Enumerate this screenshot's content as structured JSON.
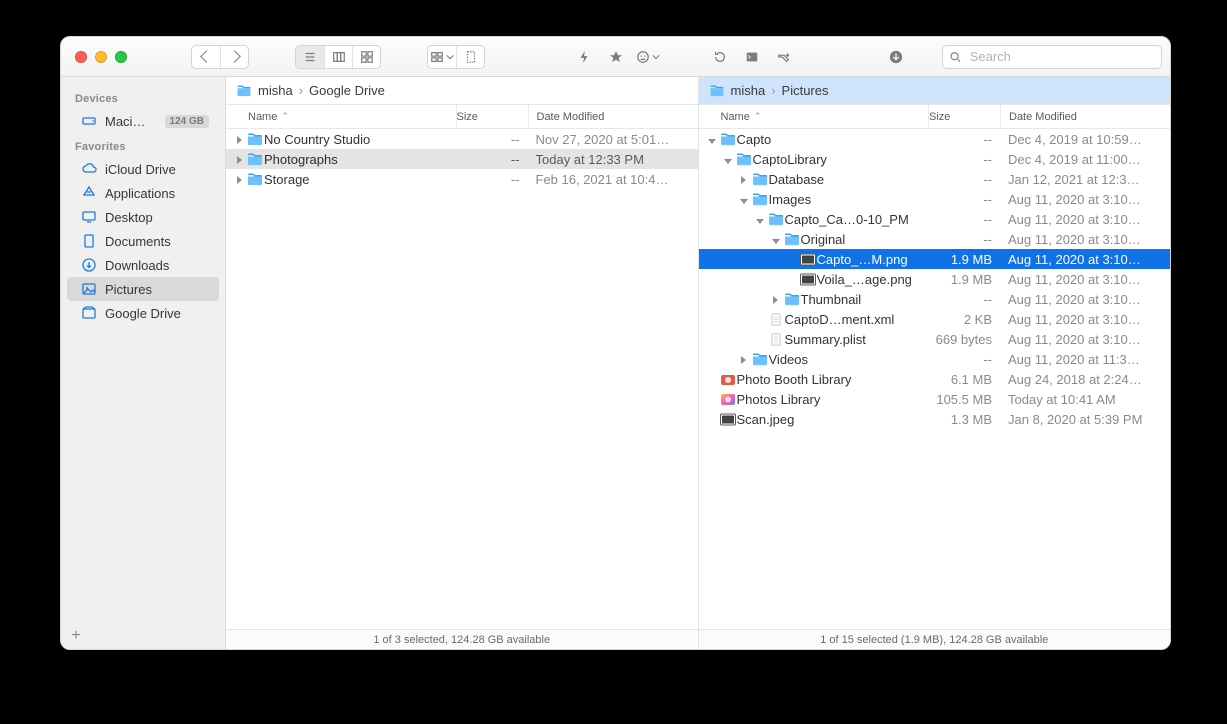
{
  "toolbar": {
    "search_placeholder": "Search"
  },
  "sidebar": {
    "groups": [
      {
        "label": "Devices",
        "items": [
          {
            "icon": "hdd-icon",
            "label": "Maci…h HD",
            "badge": "124 GB"
          }
        ]
      },
      {
        "label": "Favorites",
        "items": [
          {
            "icon": "cloud-icon",
            "label": "iCloud Drive"
          },
          {
            "icon": "apps-icon",
            "label": "Applications"
          },
          {
            "icon": "desktop-icon",
            "label": "Desktop"
          },
          {
            "icon": "documents-icon",
            "label": "Documents"
          },
          {
            "icon": "downloads-icon",
            "label": "Downloads"
          },
          {
            "icon": "pictures-icon",
            "label": "Pictures",
            "selected": true
          },
          {
            "icon": "gdrive-icon",
            "label": "Google Drive"
          }
        ]
      }
    ]
  },
  "panes": [
    {
      "highlight": false,
      "path": [
        {
          "icon": "folder",
          "label": "misha"
        },
        {
          "icon": "",
          "label": "Google Drive"
        }
      ],
      "columns": {
        "name": "Name",
        "size": "Size",
        "date": "Date Modified",
        "sort": "name-asc"
      },
      "rows": [
        {
          "depth": 0,
          "disc": "closed",
          "icon": "folder",
          "name": "No Country Studio",
          "size": "--",
          "date": "Nov 27, 2020 at 5:01…"
        },
        {
          "depth": 0,
          "disc": "closed",
          "icon": "folder",
          "name": "Photographs",
          "size": "--",
          "date": "Today at 12:33 PM",
          "sel": "grey"
        },
        {
          "depth": 0,
          "disc": "closed",
          "icon": "folder",
          "name": "Storage",
          "size": "--",
          "date": "Feb 16, 2021 at 10:4…"
        }
      ],
      "status": "1 of 3 selected, 124.28 GB available"
    },
    {
      "highlight": true,
      "path": [
        {
          "icon": "folder",
          "label": "misha"
        },
        {
          "icon": "",
          "label": "Pictures"
        }
      ],
      "columns": {
        "name": "Name",
        "size": "Size",
        "date": "Date Modified",
        "sort": "name-asc"
      },
      "rows": [
        {
          "depth": 0,
          "disc": "open",
          "icon": "folder",
          "name": "Capto",
          "size": "--",
          "date": "Dec 4, 2019 at 10:59…"
        },
        {
          "depth": 1,
          "disc": "open",
          "icon": "folder",
          "name": "CaptoLibrary",
          "size": "--",
          "date": "Dec 4, 2019 at 11:00…"
        },
        {
          "depth": 2,
          "disc": "closed",
          "icon": "folder",
          "name": "Database",
          "size": "--",
          "date": "Jan 12, 2021 at 12:3…"
        },
        {
          "depth": 2,
          "disc": "open",
          "icon": "folder",
          "name": "Images",
          "size": "--",
          "date": "Aug 11, 2020 at 3:10…"
        },
        {
          "depth": 3,
          "disc": "open",
          "icon": "folder",
          "name": "Capto_Ca…0-10_PM",
          "size": "--",
          "date": "Aug 11, 2020 at 3:10…"
        },
        {
          "depth": 4,
          "disc": "open",
          "icon": "folder",
          "name": "Original",
          "size": "--",
          "date": "Aug 11, 2020 at 3:10…"
        },
        {
          "depth": 5,
          "disc": "none",
          "icon": "image",
          "name": "Capto_…M.png",
          "size": "1.9 MB",
          "date": "Aug 11, 2020 at 3:10…",
          "sel": "blue"
        },
        {
          "depth": 5,
          "disc": "none",
          "icon": "image",
          "name": "Voila_…age.png",
          "size": "1.9 MB",
          "date": "Aug 11, 2020 at 3:10…"
        },
        {
          "depth": 4,
          "disc": "closed",
          "icon": "folder",
          "name": "Thumbnail",
          "size": "--",
          "date": "Aug 11, 2020 at 3:10…"
        },
        {
          "depth": 3,
          "disc": "none",
          "icon": "doc",
          "name": "CaptoD…ment.xml",
          "size": "2 KB",
          "date": "Aug 11, 2020 at 3:10…"
        },
        {
          "depth": 3,
          "disc": "none",
          "icon": "doc",
          "name": "Summary.plist",
          "size": "669 bytes",
          "date": "Aug 11, 2020 at 3:10…"
        },
        {
          "depth": 2,
          "disc": "closed",
          "icon": "folder",
          "name": "Videos",
          "size": "--",
          "date": "Aug 11, 2020 at 11:3…"
        },
        {
          "depth": 0,
          "disc": "none",
          "icon": "pbooth",
          "name": "Photo Booth Library",
          "size": "6.1 MB",
          "date": "Aug 24, 2018 at 2:24…"
        },
        {
          "depth": 0,
          "disc": "none",
          "icon": "photos",
          "name": "Photos Library",
          "size": "105.5 MB",
          "date": "Today at 10:41 AM"
        },
        {
          "depth": 0,
          "disc": "none",
          "icon": "image",
          "name": "Scan.jpeg",
          "size": "1.3 MB",
          "date": "Jan 8, 2020 at 5:39 PM"
        }
      ],
      "status": "1 of 15 selected (1.9 MB), 124.28 GB available"
    }
  ]
}
